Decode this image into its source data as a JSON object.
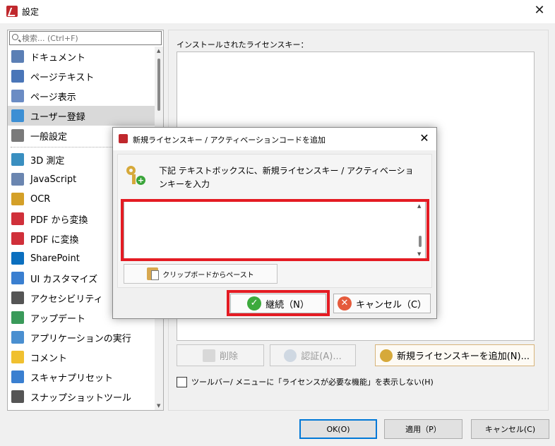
{
  "window": {
    "title": "設定"
  },
  "search": {
    "placeholder": "検索... (Ctrl+F)"
  },
  "nav": {
    "items_top": [
      {
        "label": "ドキュメント",
        "icon": "document-icon",
        "color": "#5b7fb5"
      },
      {
        "label": "ページテキスト",
        "icon": "text-t-icon",
        "color": "#4a76b8"
      },
      {
        "label": "ページ表示",
        "icon": "page-view-icon",
        "color": "#6b8cc4"
      },
      {
        "label": "ユーザー登録",
        "icon": "user-register-icon",
        "color": "#3d8fd4",
        "selected": true
      },
      {
        "label": "一般設定",
        "icon": "general-settings-icon",
        "color": "#7a7a7a"
      }
    ],
    "items_bottom": [
      {
        "label": "3D 測定",
        "icon": "3d-measure-icon",
        "color": "#3a8fc0"
      },
      {
        "label": "JavaScript",
        "icon": "javascript-icon",
        "color": "#6b86b0"
      },
      {
        "label": "OCR",
        "icon": "ocr-icon",
        "color": "#d4a028"
      },
      {
        "label": "PDF から変換",
        "icon": "pdf-convert-from-icon",
        "color": "#d0303a"
      },
      {
        "label": "PDF に変換",
        "icon": "pdf-convert-to-icon",
        "color": "#d0303a"
      },
      {
        "label": "SharePoint",
        "icon": "sharepoint-icon",
        "color": "#0b6fbf"
      },
      {
        "label": "UI カスタマイズ",
        "icon": "ui-customize-icon",
        "color": "#3a7fd0"
      },
      {
        "label": "アクセシビリティ",
        "icon": "accessibility-icon",
        "color": "#555555"
      },
      {
        "label": "アップデート",
        "icon": "update-icon",
        "color": "#3a9a5a"
      },
      {
        "label": "アプリケーションの実行",
        "icon": "run-app-icon",
        "color": "#4a8fd0"
      },
      {
        "label": "コメント",
        "icon": "comment-icon",
        "color": "#f0c030"
      },
      {
        "label": "スキャナプリセット",
        "icon": "scanner-icon",
        "color": "#3a7fd0"
      },
      {
        "label": "スナップショットツール",
        "icon": "snapshot-icon",
        "color": "#555555"
      }
    ]
  },
  "panel": {
    "license_label": "インストールされたライセンスキー：",
    "delete_label": "削除",
    "auth_label": "認証(A)...",
    "add_label": "新規ライセンスキーを追加(N)...",
    "checkbox_label": "ツールバー/ メニューに「ライセンスが必要な機能」を表示しない(H)"
  },
  "footer": {
    "ok": "OK(O)",
    "apply": "適用（P）",
    "cancel": "キャンセル(C)"
  },
  "modal": {
    "title": "新規ライセンスキー / アクティベーションコードを追加",
    "instruction": "下記 テキストボックスに、新規ライセンスキー / アクティベーションキーを入力",
    "textarea_value": "",
    "paste_label": "クリップボードからペースト",
    "continue_label": "継続（N）",
    "cancel_label": "キャンセル（C）"
  },
  "colors": {
    "highlight_red": "#e41b23",
    "focus_blue": "#0078d7",
    "selected_bg": "#d9d9d9"
  }
}
